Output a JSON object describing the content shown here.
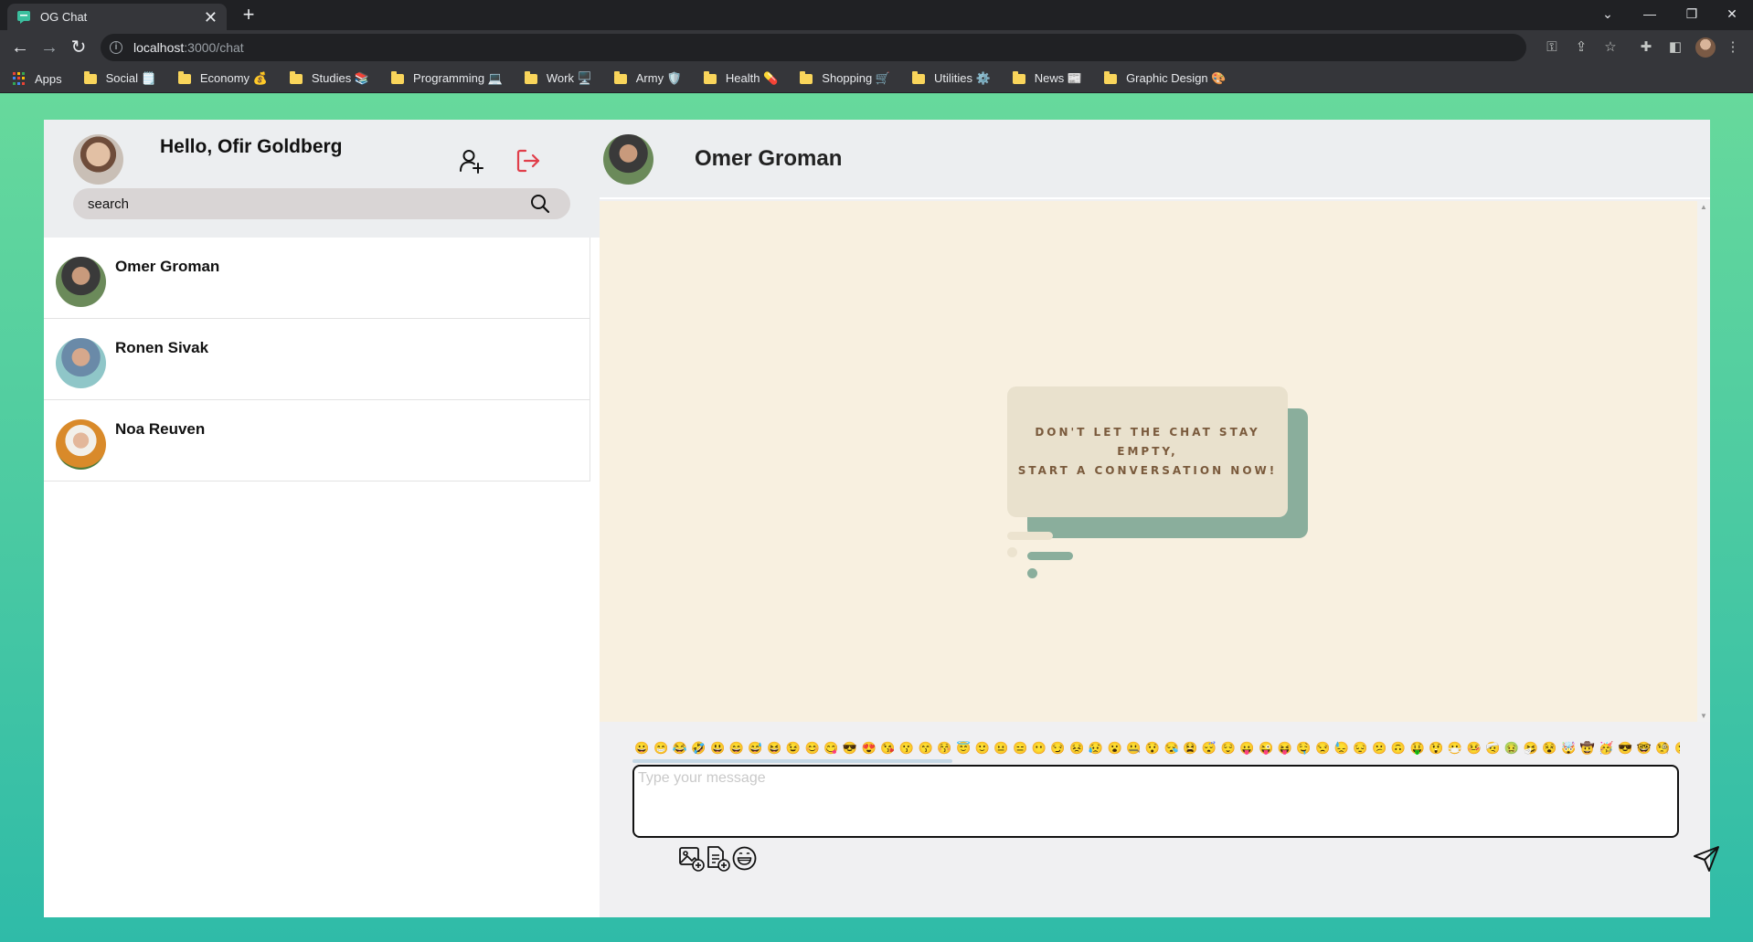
{
  "browser": {
    "tab_title": "OG Chat",
    "tab_close": "✕",
    "new_tab": "+",
    "url_host": "localhost",
    "url_path": ":3000/chat",
    "bookmarks": [
      {
        "label": "Apps"
      },
      {
        "label": "Social 🗒️"
      },
      {
        "label": "Economy 💰"
      },
      {
        "label": "Studies 📚"
      },
      {
        "label": "Programming 💻"
      },
      {
        "label": "Work 🖥️"
      },
      {
        "label": "Army 🛡️"
      },
      {
        "label": "Health 💊"
      },
      {
        "label": "Shopping 🛒"
      },
      {
        "label": "Utilities ⚙️"
      },
      {
        "label": "News 📰"
      },
      {
        "label": "Graphic Design 🎨"
      }
    ]
  },
  "sidebar": {
    "greeting": "Hello, Ofir Goldberg",
    "search_placeholder": "search",
    "add_contact_icon": "user-plus-icon",
    "logout_icon": "logout-icon",
    "logout_color": "#e03e4a",
    "contacts": [
      {
        "name": "Omer Groman"
      },
      {
        "name": "Ronen Sivak"
      },
      {
        "name": "Noa Reuven"
      }
    ]
  },
  "chat": {
    "title": "Omer Groman",
    "empty_line1": "DON'T LET THE CHAT STAY EMPTY,",
    "empty_line2": "START A CONVERSATION NOW!",
    "message_placeholder": "Type your message",
    "emojis": [
      "😀",
      "😁",
      "😂",
      "🤣",
      "😃",
      "😄",
      "😅",
      "😆",
      "😉",
      "😊",
      "😋",
      "😎",
      "😍",
      "😘",
      "😗",
      "😙",
      "😚",
      "😇",
      "🙂",
      "😐",
      "😑",
      "😶",
      "😏",
      "😣",
      "😥",
      "😮",
      "🤐",
      "😯",
      "😪",
      "😫",
      "😴",
      "😌",
      "😛",
      "😜",
      "😝",
      "🤤",
      "😒",
      "😓",
      "😔",
      "😕",
      "🙃",
      "🤑",
      "😲",
      "😷",
      "🤒",
      "🤕",
      "🤢",
      "🤧",
      "😵",
      "🤯",
      "🤠",
      "🥳",
      "😎",
      "🤓",
      "🧐",
      "😕",
      "😟",
      "🙁",
      "😮"
    ],
    "colors": {
      "accent_green": "#8aae9c",
      "card_bg": "#e9e1cd",
      "chat_bg": "#f8f0e0",
      "empty_text": "#7a5a3c"
    }
  }
}
